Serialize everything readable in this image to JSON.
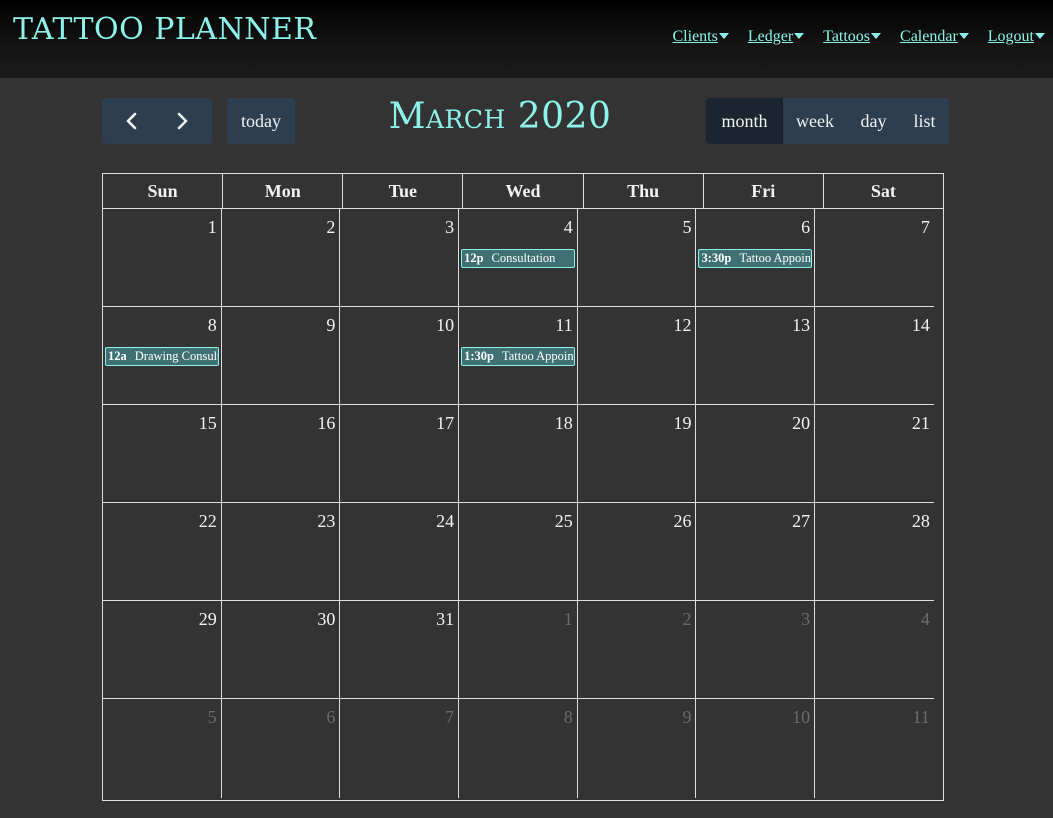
{
  "brand": "TATTOO PLANNER",
  "nav": [
    {
      "label": "Clients"
    },
    {
      "label": "Ledger"
    },
    {
      "label": "Tattoos"
    },
    {
      "label": "Calendar"
    },
    {
      "label": "Logout"
    }
  ],
  "toolbar": {
    "prev_icon": "chevron-left-icon",
    "next_icon": "chevron-right-icon",
    "today_label": "today",
    "title": "March 2020",
    "views": [
      {
        "label": "month",
        "active": true
      },
      {
        "label": "week",
        "active": false
      },
      {
        "label": "day",
        "active": false
      },
      {
        "label": "list",
        "active": false
      }
    ]
  },
  "calendar": {
    "days_of_week": [
      "Sun",
      "Mon",
      "Tue",
      "Wed",
      "Thu",
      "Fri",
      "Sat"
    ],
    "weeks": [
      [
        {
          "n": "1"
        },
        {
          "n": "2"
        },
        {
          "n": "3"
        },
        {
          "n": "4",
          "event": {
            "time": "12p",
            "title": "Consultation"
          }
        },
        {
          "n": "5"
        },
        {
          "n": "6",
          "event": {
            "time": "3:30p",
            "title": "Tattoo Appointment"
          }
        },
        {
          "n": "7"
        }
      ],
      [
        {
          "n": "8",
          "event": {
            "time": "12a",
            "title": "Drawing Consultation"
          }
        },
        {
          "n": "9"
        },
        {
          "n": "10"
        },
        {
          "n": "11",
          "event": {
            "time": "1:30p",
            "title": "Tattoo Appointment"
          }
        },
        {
          "n": "12"
        },
        {
          "n": "13"
        },
        {
          "n": "14"
        }
      ],
      [
        {
          "n": "15"
        },
        {
          "n": "16"
        },
        {
          "n": "17"
        },
        {
          "n": "18"
        },
        {
          "n": "19"
        },
        {
          "n": "20"
        },
        {
          "n": "21"
        }
      ],
      [
        {
          "n": "22"
        },
        {
          "n": "23"
        },
        {
          "n": "24"
        },
        {
          "n": "25"
        },
        {
          "n": "26"
        },
        {
          "n": "27"
        },
        {
          "n": "28"
        }
      ],
      [
        {
          "n": "29"
        },
        {
          "n": "30"
        },
        {
          "n": "31"
        },
        {
          "n": "1",
          "other": true
        },
        {
          "n": "2",
          "other": true
        },
        {
          "n": "3",
          "other": true
        },
        {
          "n": "4",
          "other": true
        }
      ],
      [
        {
          "n": "5",
          "other": true
        },
        {
          "n": "6",
          "other": true
        },
        {
          "n": "7",
          "other": true
        },
        {
          "n": "8",
          "other": true
        },
        {
          "n": "9",
          "other": true
        },
        {
          "n": "10",
          "other": true
        },
        {
          "n": "11",
          "other": true
        }
      ]
    ]
  },
  "colors": {
    "accent": "#8df3ea",
    "button_bg": "#2c3e50",
    "event_bg": "#3f7174",
    "page_bg": "#333333"
  }
}
